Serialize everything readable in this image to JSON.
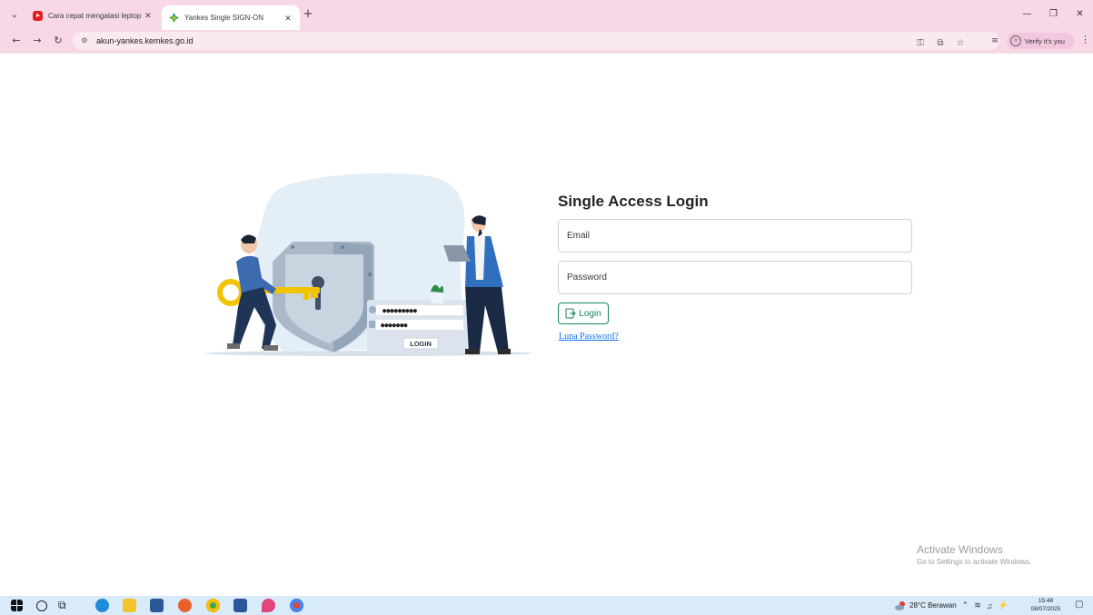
{
  "browser": {
    "tabs": [
      {
        "title": "Cara cepat mengatasi leptop yang",
        "icon": "youtube-icon",
        "active": false
      },
      {
        "title": "Yankes Single SIGN-ON",
        "icon": "kemkes-icon",
        "active": true
      }
    ],
    "url": "akun-yankes.kemkes.go.id",
    "verify_label": "Verify it's you",
    "window_controls": [
      "minimize",
      "restore",
      "close"
    ]
  },
  "login": {
    "title": "Single Access Login",
    "email_placeholder": "Email",
    "password_placeholder": "Password",
    "login_button": "Login",
    "forgot_link": "Lupa Password?"
  },
  "illustration": {
    "login_label": "LOGIN",
    "dots_row1": "●●●●●●●●●",
    "dots_row2": "●●●●●●●"
  },
  "watermark": {
    "line1": "Activate Windows",
    "line2": "Go to Settings to activate Windows."
  },
  "taskbar": {
    "weather": "28°C  Berawan",
    "time": "15:48",
    "date": "08/07/2025"
  },
  "colors": {
    "chrome_pink": "#f8d7e6",
    "login_green": "#198754",
    "link_blue": "#0d6efd",
    "taskbar_blue": "#d9eaf8"
  }
}
